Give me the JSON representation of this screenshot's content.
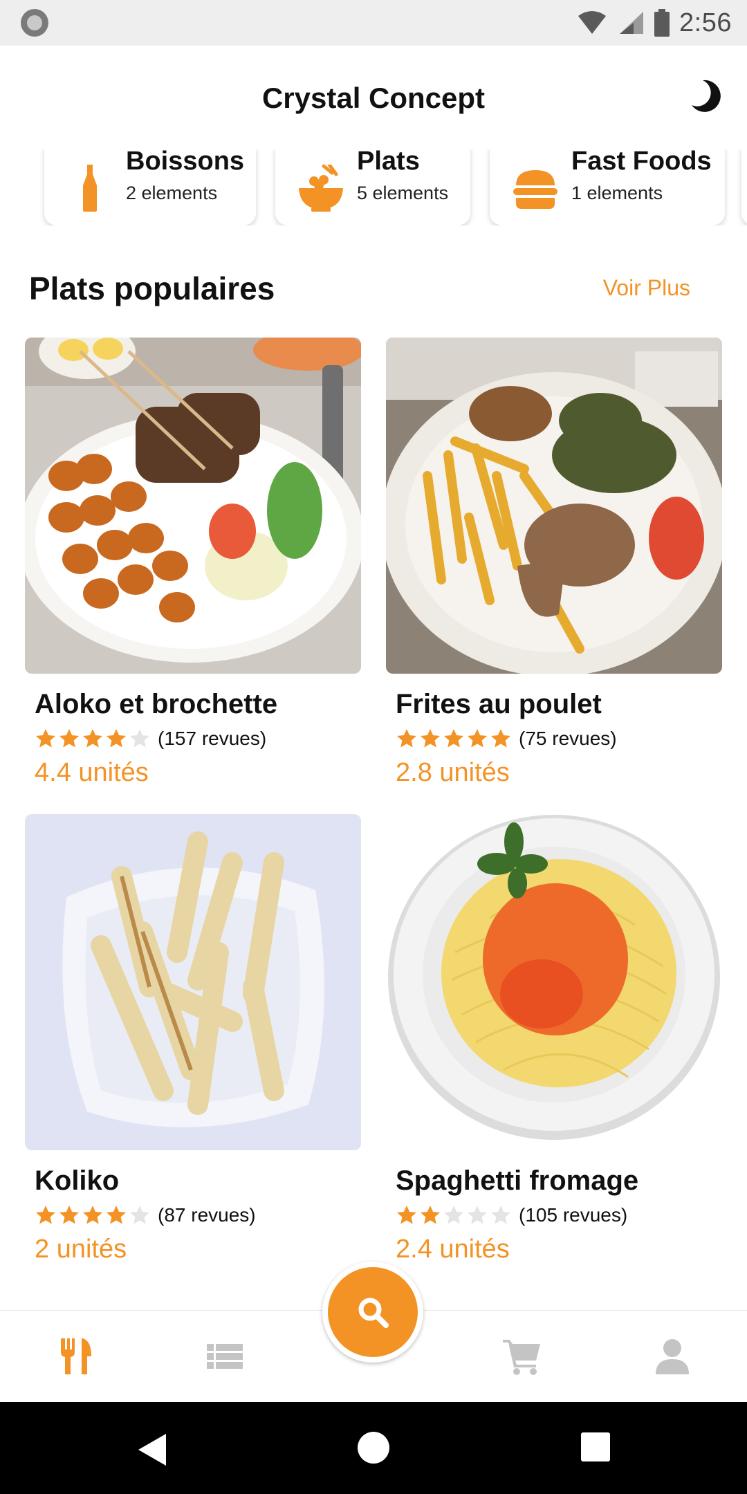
{
  "status_bar": {
    "time": "2:56"
  },
  "header": {
    "title": "Crystal Concept"
  },
  "categories": [
    {
      "name": "Boissons",
      "count": "2 elements",
      "icon": "bottle-icon"
    },
    {
      "name": "Plats",
      "count": "5 elements",
      "icon": "bowl-icon"
    },
    {
      "name": "Fast Foods",
      "count": "1 elements",
      "icon": "burger-icon"
    }
  ],
  "section": {
    "title": "Plats populaires",
    "see_more": "Voir Plus"
  },
  "dishes": [
    {
      "name": "Aloko et brochette",
      "rating": 4,
      "reviews": "(157 revues)",
      "price": "4.4 unités"
    },
    {
      "name": "Frites au poulet",
      "rating": 5,
      "reviews": "(75 revues)",
      "price": "2.8 unités"
    },
    {
      "name": "Koliko",
      "rating": 4,
      "reviews": "(87 revues)",
      "price": "2 unités"
    },
    {
      "name": "Spaghetti fromage",
      "rating": 2,
      "reviews": "(105 revues)",
      "price": "2.4 unités"
    }
  ],
  "bottom_nav": {
    "items": [
      "utensils-icon",
      "list-icon",
      "search-icon",
      "cart-icon",
      "user-icon"
    ],
    "active": "utensils-icon"
  },
  "colors": {
    "accent": "#f39225",
    "inactive": "#c4c4c4",
    "star_empty": "#e4e4e4"
  }
}
